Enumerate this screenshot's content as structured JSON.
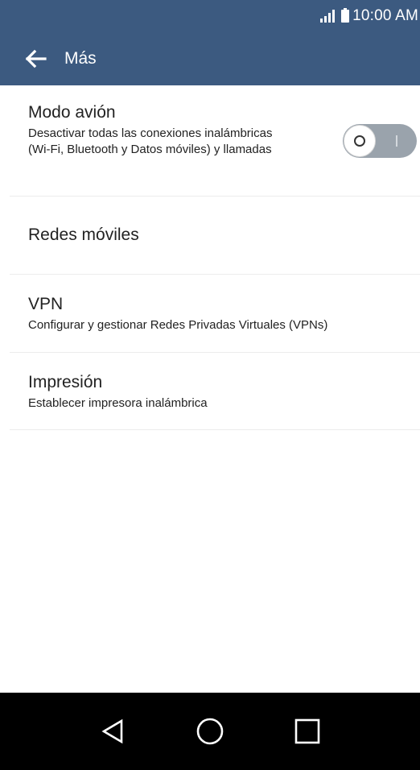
{
  "status_bar": {
    "time": "10:00 AM",
    "icons": [
      "signal-icon",
      "battery-icon"
    ]
  },
  "app_bar": {
    "title": "Más",
    "back_icon": "arrow-left-icon"
  },
  "settings": [
    {
      "title": "Modo avión",
      "subtitle": "Desactivar todas las conexiones inalámbricas (Wi-Fi, Bluetooth y Datos móviles) y llamadas",
      "toggle": {
        "state": "off"
      }
    },
    {
      "title": "Redes móviles"
    },
    {
      "title": "VPN",
      "subtitle": "Configurar y gestionar Redes Privadas Virtuales (VPNs)"
    },
    {
      "title": "Impresión",
      "subtitle": "Establecer impresora inalámbrica"
    }
  ],
  "nav_bar": {
    "buttons": [
      "back-triangle-icon",
      "home-circle-icon",
      "recents-square-icon"
    ]
  },
  "colors": {
    "app_bar": "#3c5a80",
    "toggle_track_off": "#9aa3ac",
    "nav_bar": "#000000"
  }
}
